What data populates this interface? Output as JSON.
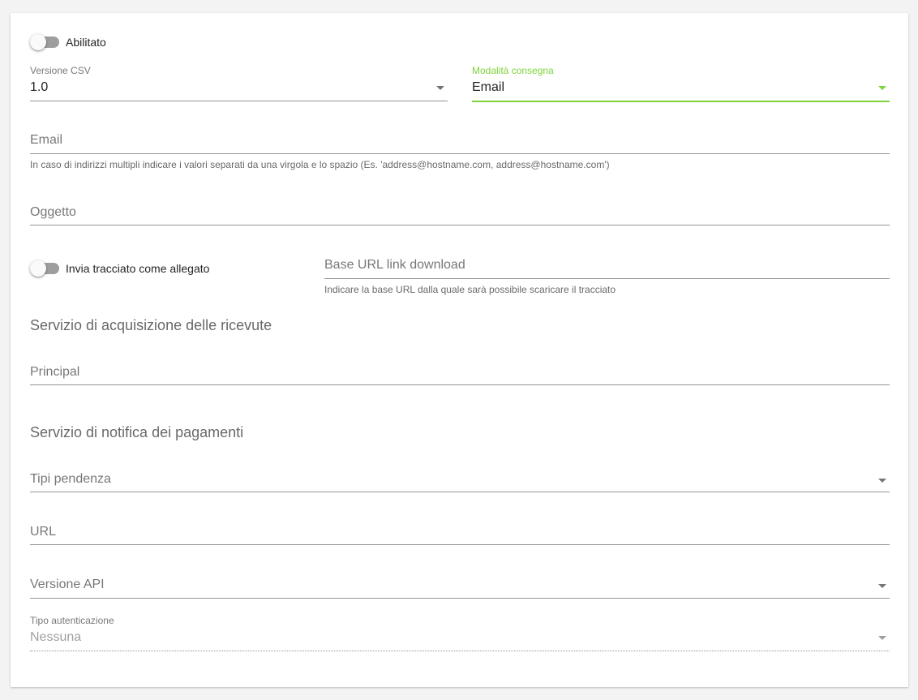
{
  "toggles": {
    "abilitato": {
      "label": "Abilitato",
      "checked": false
    },
    "invia_allegato": {
      "label": "Invia tracciato come allegato",
      "checked": false
    }
  },
  "fields": {
    "versione_csv": {
      "label": "Versione CSV",
      "value": "1.0"
    },
    "modalita_consegna": {
      "label": "Modalità consegna",
      "value": "Email"
    },
    "email": {
      "label": "Email",
      "hint": "In caso di indirizzi multipli indicare i valori separati da una virgola e lo spazio (Es. 'address@hostname.com, address@hostname.com')"
    },
    "oggetto": {
      "label": "Oggetto"
    },
    "base_url": {
      "label": "Base URL link download",
      "hint": "Indicare la base URL dalla quale sarà possibile scaricare il tracciato"
    },
    "principal": {
      "label": "Principal"
    },
    "tipi_pendenza": {
      "label": "Tipi pendenza"
    },
    "url": {
      "label": "URL"
    },
    "versione_api": {
      "label": "Versione API"
    },
    "tipo_autenticazione": {
      "label": "Tipo autenticazione",
      "value": "Nessuna"
    }
  },
  "sections": {
    "ricevute": "Servizio di acquisizione delle ricevute",
    "notifica": "Servizio di notifica dei pagamenti"
  },
  "colors": {
    "accent": "#7fd33a",
    "background": "#f3f3f3",
    "card": "#ffffff"
  },
  "icons": {
    "dropdown": "chevron-down-icon"
  }
}
